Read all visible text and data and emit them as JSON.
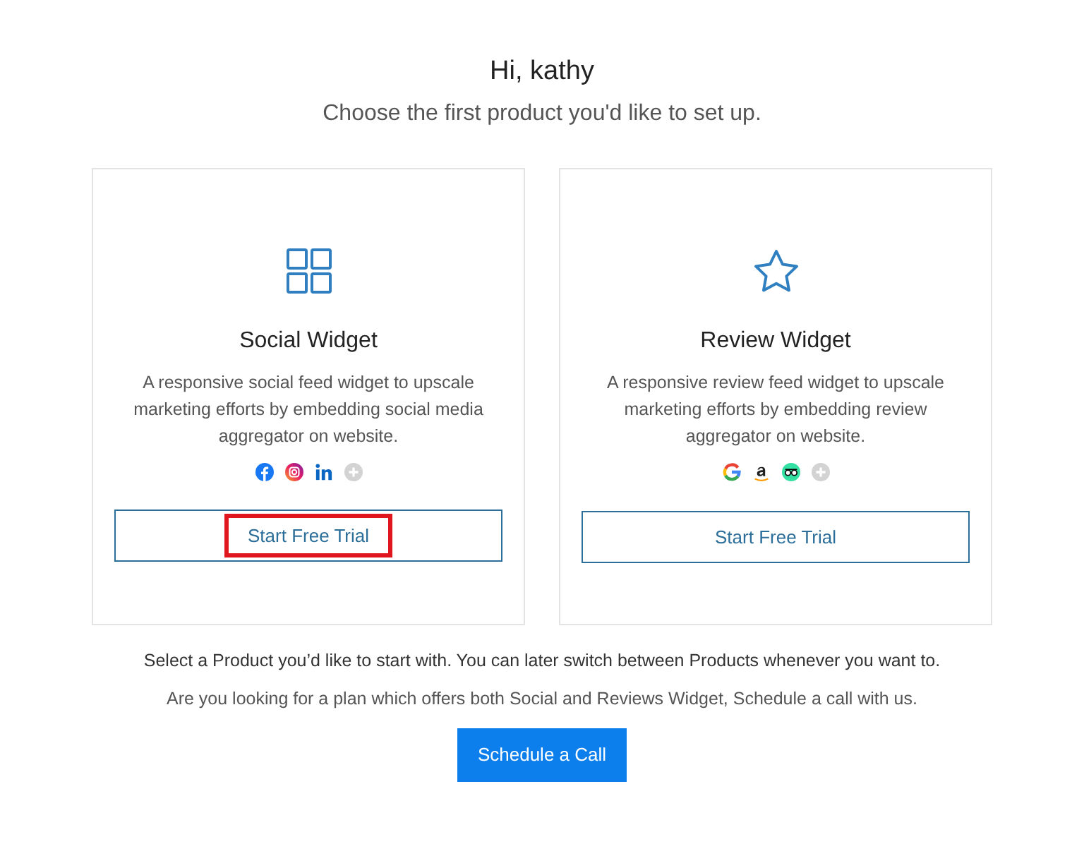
{
  "greeting": "Hi, kathy",
  "subtitle": "Choose the first product you'd like to set up.",
  "products": [
    {
      "title": "Social Widget",
      "description": "A responsive social feed widget to upscale marketing efforts by embedding social media aggregator on website.",
      "button": "Start Free Trial",
      "highlighted": true
    },
    {
      "title": "Review Widget",
      "description": "A responsive review feed widget to upscale marketing efforts by embedding review aggregator on website.",
      "button": "Start Free Trial",
      "highlighted": false
    }
  ],
  "note": "Select a Product you’d like to start with. You can later switch between Products whenever you want to.",
  "plan_text": "Are you looking for a plan which offers both Social and Reviews Widget, Schedule a call with us.",
  "call_button": "Schedule a Call"
}
